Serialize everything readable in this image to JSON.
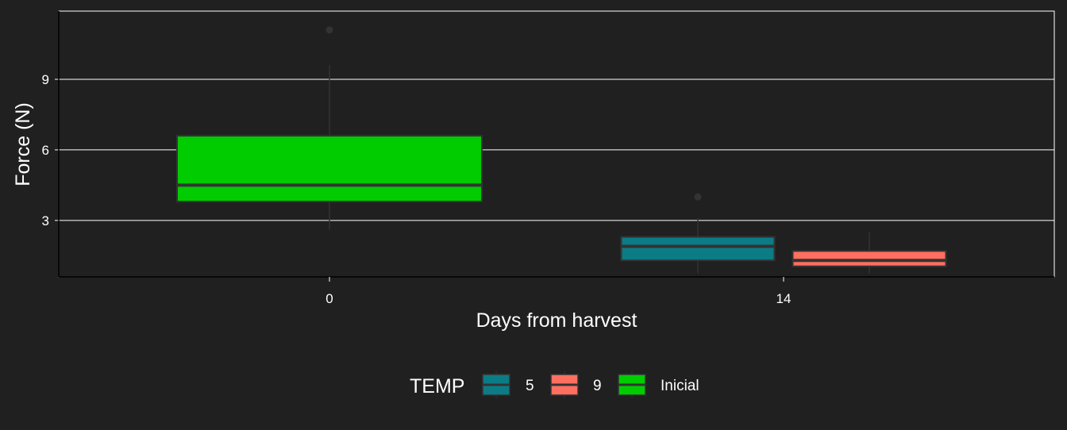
{
  "chart_data": {
    "type": "boxplot",
    "xlabel": "Days from harvest",
    "ylabel": "Force (N)",
    "x_categories": [
      "0",
      "14"
    ],
    "y_ticks": [
      3,
      6,
      9
    ],
    "ylim": [
      0.6,
      11.9
    ],
    "grid": "horizontal major only",
    "legend": {
      "title": "TEMP",
      "position": "bottom",
      "entries": [
        {
          "label": "5",
          "color": "#0B7C86"
        },
        {
          "label": "9",
          "color": "#FF6F5F"
        },
        {
          "label": "Inicial",
          "color": "#00CC00"
        }
      ]
    },
    "boxes": [
      {
        "x": "0",
        "group": "Inicial",
        "whisker_low": 2.6,
        "q1": 3.8,
        "median": 4.5,
        "q3": 6.6,
        "whisker_high": 9.6,
        "outliers": [
          11.1
        ]
      },
      {
        "x": "14",
        "group": "5",
        "whisker_low": 0.75,
        "q1": 1.3,
        "median": 1.9,
        "q3": 2.3,
        "whisker_high": 3.1,
        "outliers": [
          4.0
        ]
      },
      {
        "x": "14",
        "group": "9",
        "whisker_low": 0.75,
        "q1": 1.05,
        "median": 1.3,
        "q3": 1.7,
        "whisker_high": 2.5,
        "outliers": []
      }
    ]
  }
}
